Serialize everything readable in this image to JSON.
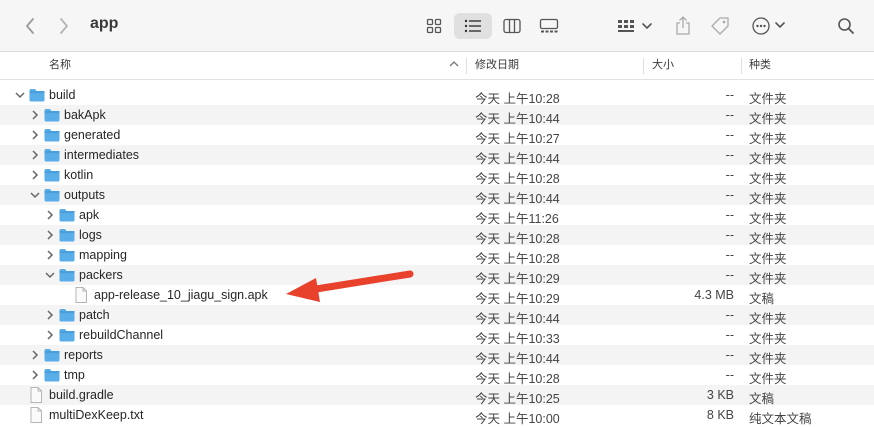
{
  "window": {
    "title": "app"
  },
  "toolbar": {
    "back_icon": "chevron-left-icon",
    "forward_icon": "chevron-right-icon",
    "views": [
      "icon-view-icon",
      "list-view-icon",
      "column-view-icon",
      "gallery-view-icon"
    ],
    "active_view": "list-view-icon"
  },
  "header": {
    "name": "名称",
    "date": "修改日期",
    "size": "大小",
    "kind": "种类"
  },
  "rows": [
    {
      "name": "build",
      "date": "今天 上午10:28",
      "size": "--",
      "kind": "文件夹",
      "depth": 0,
      "type": "folder",
      "state": "open"
    },
    {
      "name": "bakApk",
      "date": "今天 上午10:44",
      "size": "--",
      "kind": "文件夹",
      "depth": 1,
      "type": "folder",
      "state": "closed"
    },
    {
      "name": "generated",
      "date": "今天 上午10:27",
      "size": "--",
      "kind": "文件夹",
      "depth": 1,
      "type": "folder",
      "state": "closed"
    },
    {
      "name": "intermediates",
      "date": "今天 上午10:44",
      "size": "--",
      "kind": "文件夹",
      "depth": 1,
      "type": "folder",
      "state": "closed"
    },
    {
      "name": "kotlin",
      "date": "今天 上午10:28",
      "size": "--",
      "kind": "文件夹",
      "depth": 1,
      "type": "folder",
      "state": "closed"
    },
    {
      "name": "outputs",
      "date": "今天 上午10:44",
      "size": "--",
      "kind": "文件夹",
      "depth": 1,
      "type": "folder",
      "state": "open"
    },
    {
      "name": "apk",
      "date": "今天 上午11:26",
      "size": "--",
      "kind": "文件夹",
      "depth": 2,
      "type": "folder",
      "state": "closed"
    },
    {
      "name": "logs",
      "date": "今天 上午10:28",
      "size": "--",
      "kind": "文件夹",
      "depth": 2,
      "type": "folder",
      "state": "closed"
    },
    {
      "name": "mapping",
      "date": "今天 上午10:28",
      "size": "--",
      "kind": "文件夹",
      "depth": 2,
      "type": "folder",
      "state": "closed"
    },
    {
      "name": "packers",
      "date": "今天 上午10:29",
      "size": "--",
      "kind": "文件夹",
      "depth": 2,
      "type": "folder",
      "state": "open"
    },
    {
      "name": "app-release_10_jiagu_sign.apk",
      "date": "今天 上午10:29",
      "size": "4.3 MB",
      "kind": "文稿",
      "depth": 3,
      "type": "file",
      "state": "none"
    },
    {
      "name": "patch",
      "date": "今天 上午10:44",
      "size": "--",
      "kind": "文件夹",
      "depth": 2,
      "type": "folder",
      "state": "closed"
    },
    {
      "name": "rebuildChannel",
      "date": "今天 上午10:33",
      "size": "--",
      "kind": "文件夹",
      "depth": 2,
      "type": "folder",
      "state": "closed"
    },
    {
      "name": "reports",
      "date": "今天 上午10:44",
      "size": "--",
      "kind": "文件夹",
      "depth": 1,
      "type": "folder",
      "state": "closed"
    },
    {
      "name": "tmp",
      "date": "今天 上午10:28",
      "size": "--",
      "kind": "文件夹",
      "depth": 1,
      "type": "folder",
      "state": "closed"
    },
    {
      "name": "build.gradle",
      "date": "今天 上午10:25",
      "size": "3 KB",
      "kind": "文稿",
      "depth": 0,
      "type": "file",
      "state": "none"
    },
    {
      "name": "multiDexKeep.txt",
      "date": "今天 上午10:00",
      "size": "8 KB",
      "kind": "纯文本文稿",
      "depth": 0,
      "type": "file",
      "state": "none"
    }
  ],
  "colors": {
    "folder": "#5aaee8",
    "folder_tab": "#4a9edc",
    "arrow": "#e8412c",
    "stripe": "#f4f4f4"
  }
}
